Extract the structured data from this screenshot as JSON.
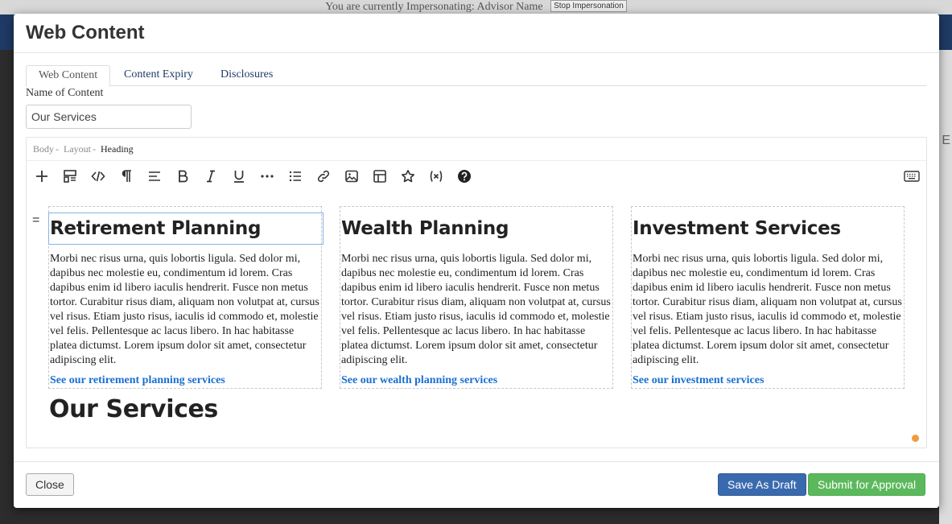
{
  "background": {
    "banner_text": "You are currently Impersonating: Advisor Name",
    "stop_button": "Stop Impersonation",
    "edge_letter": "E"
  },
  "modal": {
    "title": "Web Content",
    "tabs": [
      {
        "label": "Web Content",
        "active": true
      },
      {
        "label": "Content Expiry",
        "active": false
      },
      {
        "label": "Disclosures",
        "active": false
      }
    ],
    "name_label": "Name of Content",
    "name_value": "Our Services",
    "editor": {
      "breadcrumb": [
        "Body",
        "Layout",
        "Heading"
      ],
      "toolbar_icons": [
        "plus-icon",
        "block-layout-icon",
        "code-icon",
        "paragraph-icon",
        "align-icon",
        "bold-icon",
        "italic-icon",
        "underline-icon",
        "more-icon",
        "list-icon",
        "link-icon",
        "image-icon",
        "table-icon",
        "star-icon",
        "variable-icon",
        "help-icon",
        "keyboard-icon"
      ],
      "drag_handle": "=",
      "columns": [
        {
          "heading": "Retirement Planning",
          "text": "Morbi nec risus urna, quis lobortis ligula. Sed dolor mi, dapibus nec molestie eu, condimentum id lorem. Cras dapibus enim id libero iaculis hendrerit. Fusce non metus tortor. Curabitur risus diam, aliquam non volutpat at, cursus vel risus. Etiam justo risus, iaculis id commodo et, molestie vel felis. Pellentesque ac lacus libero. In hac habitasse platea dictumst. Lorem ipsum dolor sit amet, consectetur adipiscing elit.",
          "link": "See our retirement planning services"
        },
        {
          "heading": "Wealth Planning",
          "text": "Morbi nec risus urna, quis lobortis ligula. Sed dolor mi, dapibus nec molestie eu, condimentum id lorem. Cras dapibus enim id libero iaculis hendrerit. Fusce non metus tortor. Curabitur risus diam, aliquam non volutpat at, cursus vel risus. Etiam justo risus, iaculis id commodo et, molestie vel felis. Pellentesque ac lacus libero. In hac habitasse platea dictumst. Lorem ipsum dolor sit amet, consectetur adipiscing elit.",
          "link": "See our wealth planning services"
        },
        {
          "heading": "Investment Services",
          "text": "Morbi nec risus urna, quis lobortis ligula. Sed dolor mi, dapibus nec molestie eu, condimentum id lorem. Cras dapibus enim id libero iaculis hendrerit. Fusce non metus tortor. Curabitur risus diam, aliquam non volutpat at, cursus vel risus. Etiam justo risus, iaculis id commodo et, molestie vel felis. Pellentesque ac lacus libero. In hac habitasse platea dictumst. Lorem ipsum dolor sit amet, consectetur adipiscing elit.",
          "link": "See our investment services"
        }
      ],
      "big_heading": "Our Services"
    },
    "footer": {
      "close_label": "Close",
      "draft_label": "Save As Draft",
      "submit_label": "Submit for Approval"
    }
  },
  "colors": {
    "link": "#1a6fd0",
    "draft_button": "#3a6aae",
    "submit_button": "#5cb85c",
    "status_dot": "#f39a3c"
  }
}
